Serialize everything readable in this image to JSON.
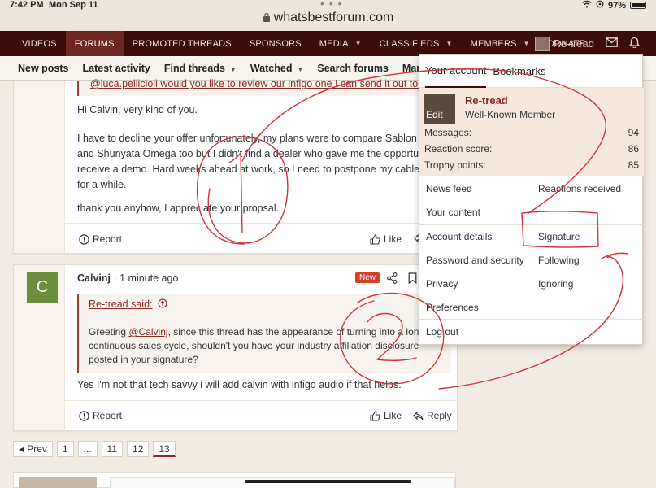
{
  "status": {
    "time": "7:42 PM",
    "date": "Mon Sep 11",
    "url": "whatsbestforum.com",
    "battery": "97%"
  },
  "nav": {
    "tabs": [
      {
        "label": "VIDEOS"
      },
      {
        "label": "FORUMS"
      },
      {
        "label": "PROMOTED THREADS"
      },
      {
        "label": "SPONSORS"
      },
      {
        "label": "MEDIA"
      },
      {
        "label": "CLASSIFIEDS"
      },
      {
        "label": "MEMBERS"
      },
      {
        "label": "DONATE"
      }
    ],
    "username": "Re-tread"
  },
  "subnav": {
    "items": [
      "New posts",
      "Latest activity",
      "Find threads",
      "Watched",
      "Search forums",
      "Mark forums rea"
    ]
  },
  "post1": {
    "quote_fragment": "@luca.pellicioli would you like to review our infigo one I can send it out to you",
    "greeting": "Hi Calvin, very kind of you.",
    "para1_line1": "I have to decline your offer unfortunately, my plans were to compare Sablon",
    "para1_line2": "and Shunyata Omega too but I didn't find a dealer who gave me the opportu",
    "para1_line3": "receive a demo. Hard weeks ahead at work, so I need to postpone my cable",
    "para1_line4": "for a while.",
    "para2": "thank you anyhow, I appreciate your propsal.",
    "report": "Report",
    "like": "Like"
  },
  "post2": {
    "avatar_letter": "C",
    "author": "Calvinj",
    "time": "· 1 minute ago",
    "badge": "New",
    "quote_header": "Re-tread said:",
    "quote_line1_pre": "Greeting ",
    "quote_mention": "@Calvinj",
    "quote_line1_post": ", since this thread has the appearance of turning into a long",
    "quote_line2": "continuous sales cycle, shouldn't you have your industry affiliation disclosure",
    "quote_line3": "posted in your signature?",
    "reply_text": "Yes I'm not that tech savvy i will add calvin with infigo audio if that helps.",
    "report": "Report",
    "like": "Like",
    "reply": "Reply"
  },
  "pager": {
    "prev": "Prev",
    "pages": [
      "1",
      "...",
      "11",
      "12",
      "13"
    ]
  },
  "dropdown": {
    "tab_account": "Your account",
    "tab_bookmarks": "Bookmarks",
    "name": "Re-tread",
    "member_title": "Well-Known Member",
    "edit": "Edit",
    "stats": [
      {
        "label": "Messages:",
        "value": "94"
      },
      {
        "label": "Reaction score:",
        "value": "86"
      },
      {
        "label": "Trophy points:",
        "value": "85"
      }
    ],
    "left_items": [
      "News feed",
      "Your content",
      "Account details",
      "Password and security",
      "Privacy",
      "Preferences",
      "Log out"
    ],
    "right_items": [
      "Reactions received",
      "Signature",
      "Following",
      "Ignoring"
    ]
  },
  "colors": {
    "navbar": "#3d0d0a",
    "accent": "#8b2a20",
    "annotation": "#d0343a"
  }
}
